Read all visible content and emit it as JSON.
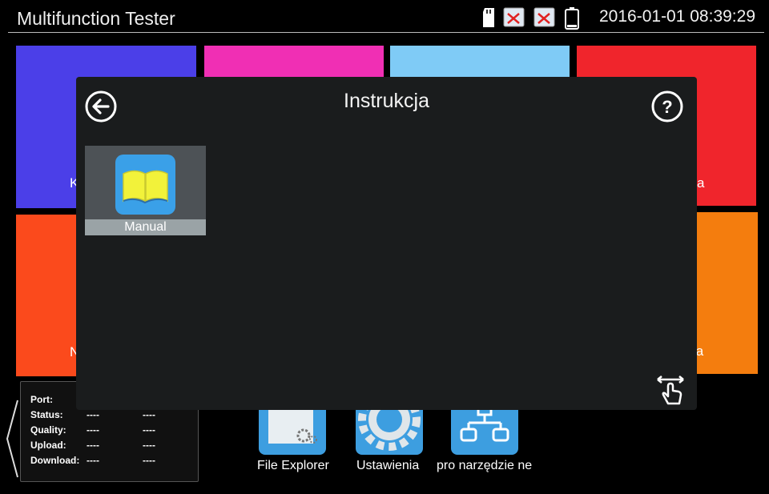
{
  "statusbar": {
    "title": "Multifunction Tester",
    "datetime": "2016-01-01 08:39:29",
    "icons": [
      "sd-card-icon",
      "network-disconnected-icon",
      "network-disconnected-icon",
      "battery-icon"
    ]
  },
  "tiles": {
    "labels": [
      "K",
      "a",
      "N",
      "ja"
    ],
    "colors": [
      "#4b3fe8",
      "#f02fb4",
      "#7fcbf6",
      "#f0252c",
      "#fb4a1c",
      "#f47d0e"
    ]
  },
  "info_panel": {
    "rows": [
      {
        "label": "Port:",
        "v1": "",
        "v2": ""
      },
      {
        "label": "Status:",
        "v1": "----",
        "v2": "----"
      },
      {
        "label": "Quality:",
        "v1": "----",
        "v2": "----"
      },
      {
        "label": "Upload:",
        "v1": "----",
        "v2": "----"
      },
      {
        "label": "Download:",
        "v1": "----",
        "v2": "----"
      }
    ]
  },
  "apps": [
    {
      "label": "File Explorer",
      "icon": "file-explorer-icon"
    },
    {
      "label": "Ustawienia",
      "icon": "settings-gear-icon"
    },
    {
      "label": "pro narzędzie ne",
      "icon": "network-tool-icon"
    }
  ],
  "dialog": {
    "title": "Instrukcja",
    "items": [
      {
        "label": "Manual",
        "icon": "book-icon"
      }
    ]
  }
}
